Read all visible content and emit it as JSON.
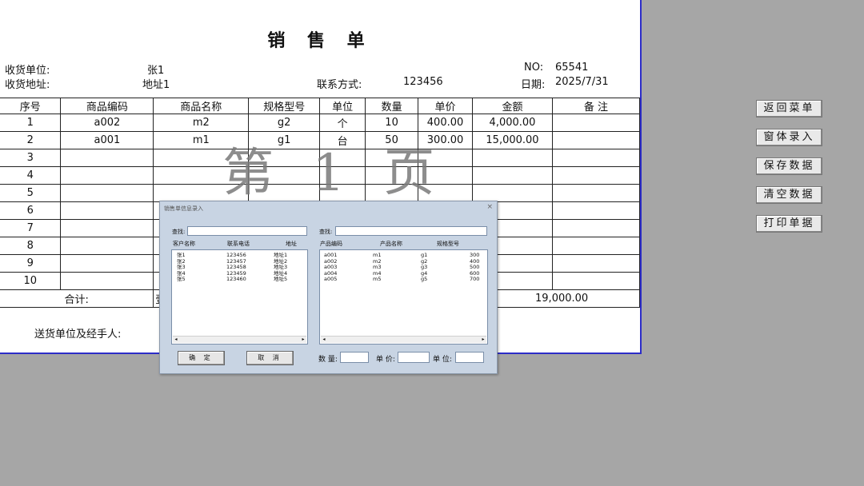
{
  "document": {
    "title": "销 售 单",
    "receiver_label": "收货单位:",
    "receiver_value": "张1",
    "address_label": "收货地址:",
    "address_value": "地址1",
    "contact_label": "联系方式:",
    "contact_value": "123456",
    "no_label": "NO:",
    "no_value": "65541",
    "date_label": "日期:",
    "date_value": "2025/7/31",
    "columns": [
      "序号",
      "商品编码",
      "商品名称",
      "规格型号",
      "单位",
      "数量",
      "单价",
      "金额",
      "备 注"
    ],
    "rows": [
      [
        "1",
        "a002",
        "m2",
        "g2",
        "个",
        "10",
        "400.00",
        "4,000.00",
        ""
      ],
      [
        "2",
        "a001",
        "m1",
        "g1",
        "台",
        "50",
        "300.00",
        "15,000.00",
        ""
      ],
      [
        "3",
        "",
        "",
        "",
        "",
        "",
        "",
        "",
        ""
      ],
      [
        "4",
        "",
        "",
        "",
        "",
        "",
        "",
        "",
        ""
      ],
      [
        "5",
        "",
        "",
        "",
        "",
        "",
        "",
        "",
        ""
      ],
      [
        "6",
        "",
        "",
        "",
        "",
        "",
        "",
        "",
        ""
      ],
      [
        "7",
        "",
        "",
        "",
        "",
        "",
        "",
        "",
        ""
      ],
      [
        "8",
        "",
        "",
        "",
        "",
        "",
        "",
        "",
        ""
      ],
      [
        "9",
        "",
        "",
        "",
        "",
        "",
        "",
        "",
        ""
      ],
      [
        "10",
        "",
        "",
        "",
        "",
        "",
        "",
        "",
        ""
      ]
    ],
    "total_label": "合计:",
    "total_partial": "壹",
    "total_value": "19,000.00",
    "footer_label": "送货单位及经手人:",
    "watermark": "第 1 页"
  },
  "side_buttons": [
    "返回菜单",
    "窗体录入",
    "保存数据",
    "清空数据",
    "打印单据"
  ],
  "dialog": {
    "title": "销售单信息录入",
    "close": "×",
    "left_search_label": "查找:",
    "left_columns": [
      "客户名称",
      "联系电话",
      "地址"
    ],
    "customers": [
      [
        "张1",
        "123456",
        "地址1"
      ],
      [
        "张2",
        "123457",
        "地址2"
      ],
      [
        "张3",
        "123458",
        "地址3"
      ],
      [
        "张4",
        "123459",
        "地址4"
      ],
      [
        "张5",
        "123460",
        "地址5"
      ]
    ],
    "right_search_label": "查找:",
    "right_columns": [
      "产品编码",
      "产品名称",
      "规格型号"
    ],
    "products": [
      [
        "a001",
        "m1",
        "g1",
        "300"
      ],
      [
        "a002",
        "m2",
        "g2",
        "400"
      ],
      [
        "a003",
        "m3",
        "g3",
        "500"
      ],
      [
        "a004",
        "m4",
        "g4",
        "600"
      ],
      [
        "a005",
        "m5",
        "g5",
        "700"
      ]
    ],
    "ok_label": "确 定",
    "cancel_label": "取 消",
    "qty_label": "数 量:",
    "price_label": "单 价:",
    "unit_label": "单 位:"
  }
}
